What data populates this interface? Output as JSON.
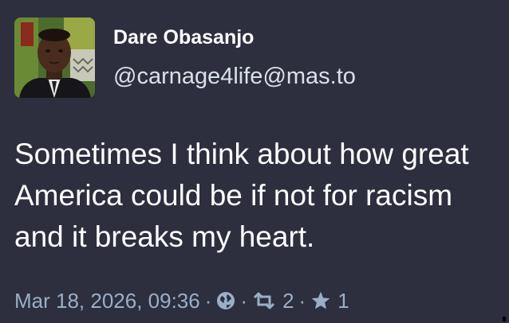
{
  "post": {
    "author": {
      "display_name": "Dare Obasanjo",
      "handle": "@carnage4life@mas.to"
    },
    "content": "Sometimes I think about how great America could be if not for racism and it breaks my heart.",
    "meta": {
      "timestamp": "Mar 18, 2026, 09:36",
      "separator": "·",
      "visibility_icon": "globe-icon",
      "boost_icon": "boost-icon",
      "boost_count": "2",
      "favourite_icon": "star-icon",
      "favourite_count": "1"
    }
  },
  "colors": {
    "background": "#2d2f3e",
    "text": "#ffffff",
    "secondary_text": "#d9e1e8",
    "muted_text": "#9baec8"
  }
}
